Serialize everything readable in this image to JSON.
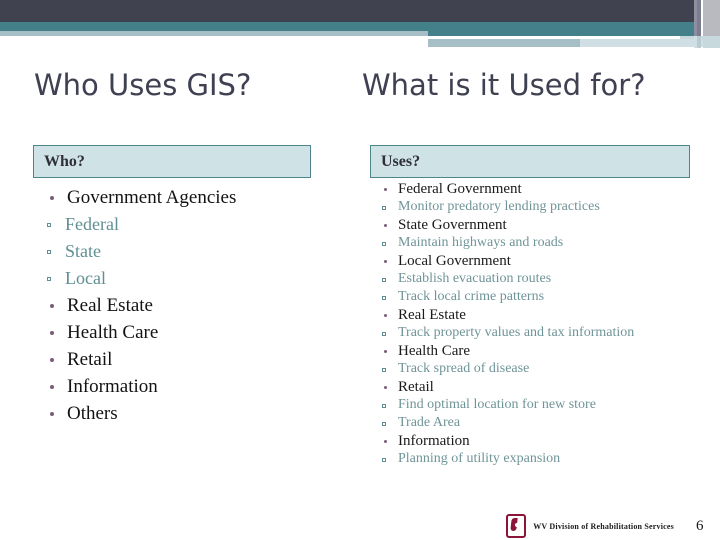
{
  "slide": {
    "title_left": "Who Uses GIS?",
    "title_right": "What is it Used for?"
  },
  "columns": {
    "left": {
      "header": "Who?",
      "items": [
        {
          "label": "Government Agencies",
          "children": [
            "Federal",
            "State",
            "Local"
          ]
        },
        {
          "label": "Real Estate",
          "children": []
        },
        {
          "label": "Health Care",
          "children": []
        },
        {
          "label": "Retail",
          "children": []
        },
        {
          "label": "Information",
          "children": []
        },
        {
          "label": "Others",
          "children": []
        }
      ]
    },
    "right": {
      "header": "Uses?",
      "items": [
        {
          "label": "Federal Government",
          "children": [
            "Monitor predatory lending practices"
          ]
        },
        {
          "label": "State Government",
          "children": [
            "Maintain highways and roads"
          ]
        },
        {
          "label": "Local Government",
          "children": [
            "Establish evacuation routes",
            "Track local crime patterns"
          ]
        },
        {
          "label": "Real Estate",
          "children": [
            "Track property values and tax information"
          ]
        },
        {
          "label": "Health Care",
          "children": [
            "Track spread of disease"
          ]
        },
        {
          "label": "Retail",
          "children": [
            "Find optimal location for new store",
            "Trade Area"
          ]
        },
        {
          "label": "Information",
          "children": [
            "Planning of utility expansion"
          ]
        }
      ]
    }
  },
  "footer": {
    "logo_name": "wv-drs-logo-icon",
    "text": "WV Division of Rehabilitation Services",
    "page_number": "6"
  },
  "colors": {
    "header_dark": "#41424f",
    "header_teal": "#44808a",
    "header_steel": "#a6bfc6",
    "box_fill": "#cfe2e5",
    "box_border": "#4c858e",
    "sub_text": "#5f8f94",
    "bullet": "#7b5d7b",
    "logo": "#8a1538"
  }
}
